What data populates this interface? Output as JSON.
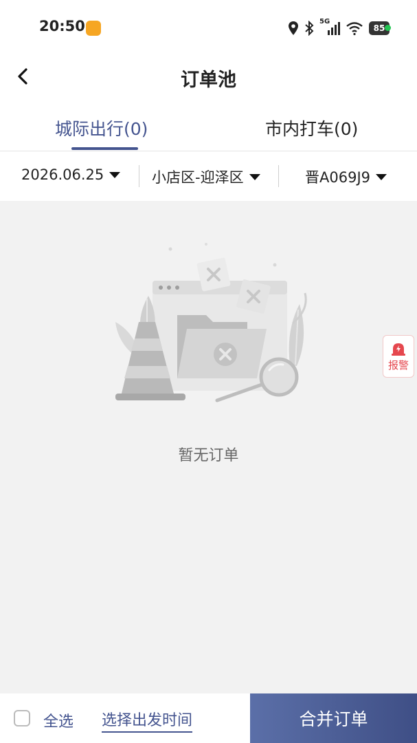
{
  "status_bar": {
    "time": "20:50",
    "network": "5G",
    "battery": "85",
    "icons": [
      "location-icon",
      "bluetooth-icon",
      "signal-icon",
      "wifi-icon",
      "battery-icon"
    ]
  },
  "header": {
    "title": "订单池"
  },
  "tabs": [
    {
      "label": "城际出行(0)",
      "active": true
    },
    {
      "label": "市内打车(0)",
      "active": false
    }
  ],
  "filters": {
    "date": "2026.06.25",
    "area": "小店区-迎泽区",
    "plate": "晋A069J9"
  },
  "empty_state": {
    "message": "暂无订单"
  },
  "report_button": {
    "label": "报警"
  },
  "bottom_bar": {
    "select_all": "全选",
    "depart_time": "选择出发时间",
    "merge": "合并订单"
  },
  "colors": {
    "accent": "#44548f",
    "alert": "#e5474e",
    "background": "#f2f2f2"
  }
}
